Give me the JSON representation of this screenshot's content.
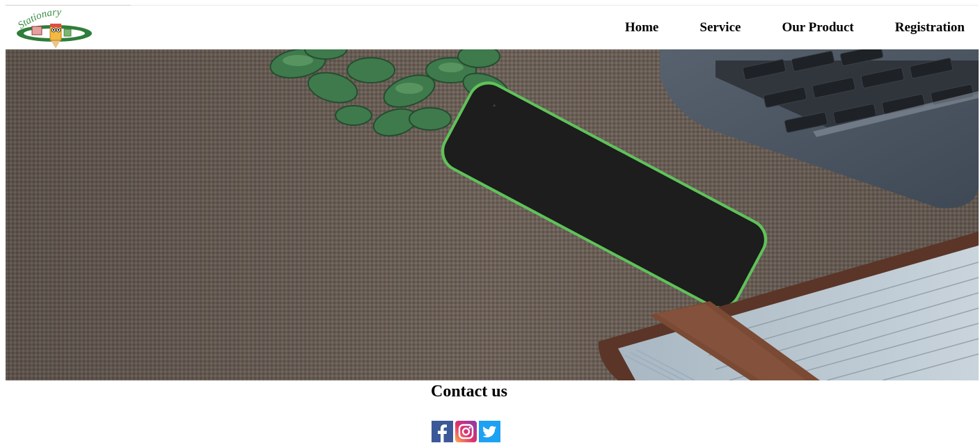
{
  "header": {
    "logo_text": "Stationary",
    "nav": [
      {
        "label": "Home"
      },
      {
        "label": "Service"
      },
      {
        "label": "Our Product"
      },
      {
        "label": "Registration"
      }
    ]
  },
  "hero": {
    "image": "desk-flatlay-photo",
    "colors": {
      "burlap": "#6a5f56",
      "phone_edge": "#5fc25a",
      "laptop": "#4d5866",
      "plant": "#3f7a4c"
    }
  },
  "contact": {
    "title": "Contact us",
    "social": [
      {
        "name": "facebook-icon",
        "color": "#3b5998"
      },
      {
        "name": "instagram-icon",
        "color": "#c13584"
      },
      {
        "name": "twitter-icon",
        "color": "#1da1f2"
      }
    ]
  }
}
